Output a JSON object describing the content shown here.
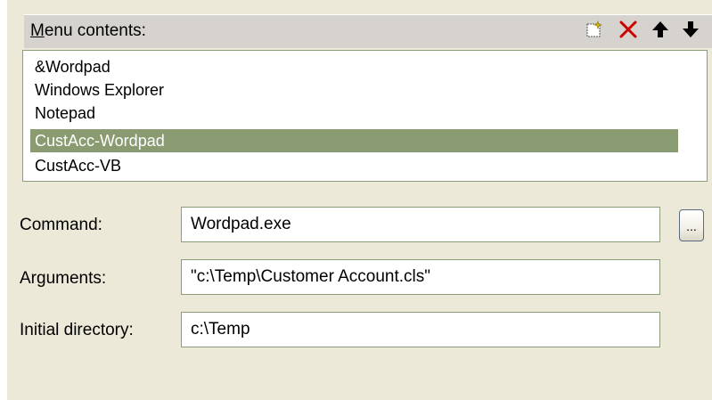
{
  "menu_contents": {
    "label_underlined": "M",
    "label_rest": "enu contents:",
    "toolbar": [
      {
        "name": "new-item-icon"
      },
      {
        "name": "delete-icon",
        "color": "#cc0000"
      },
      {
        "name": "move-up-icon"
      },
      {
        "name": "move-down-icon"
      }
    ],
    "items": [
      {
        "label": "&Wordpad",
        "selected": false
      },
      {
        "label": "Windows Explorer",
        "selected": false
      },
      {
        "label": "Notepad",
        "selected": false
      },
      {
        "label": "CustAcc-Wordpad",
        "selected": true
      },
      {
        "label": "CustAcc-VB",
        "selected": false
      }
    ],
    "selection_color": "#8a9b71"
  },
  "form": {
    "command_label": "Command:",
    "command_value": "Wordpad.exe",
    "browse_label": "...",
    "arguments_label": "Arguments:",
    "arguments_value": "\"c:\\Temp\\Customer Account.cls\"",
    "initial_directory_label": "Initial directory:",
    "initial_directory_value": "c:\\Temp"
  }
}
